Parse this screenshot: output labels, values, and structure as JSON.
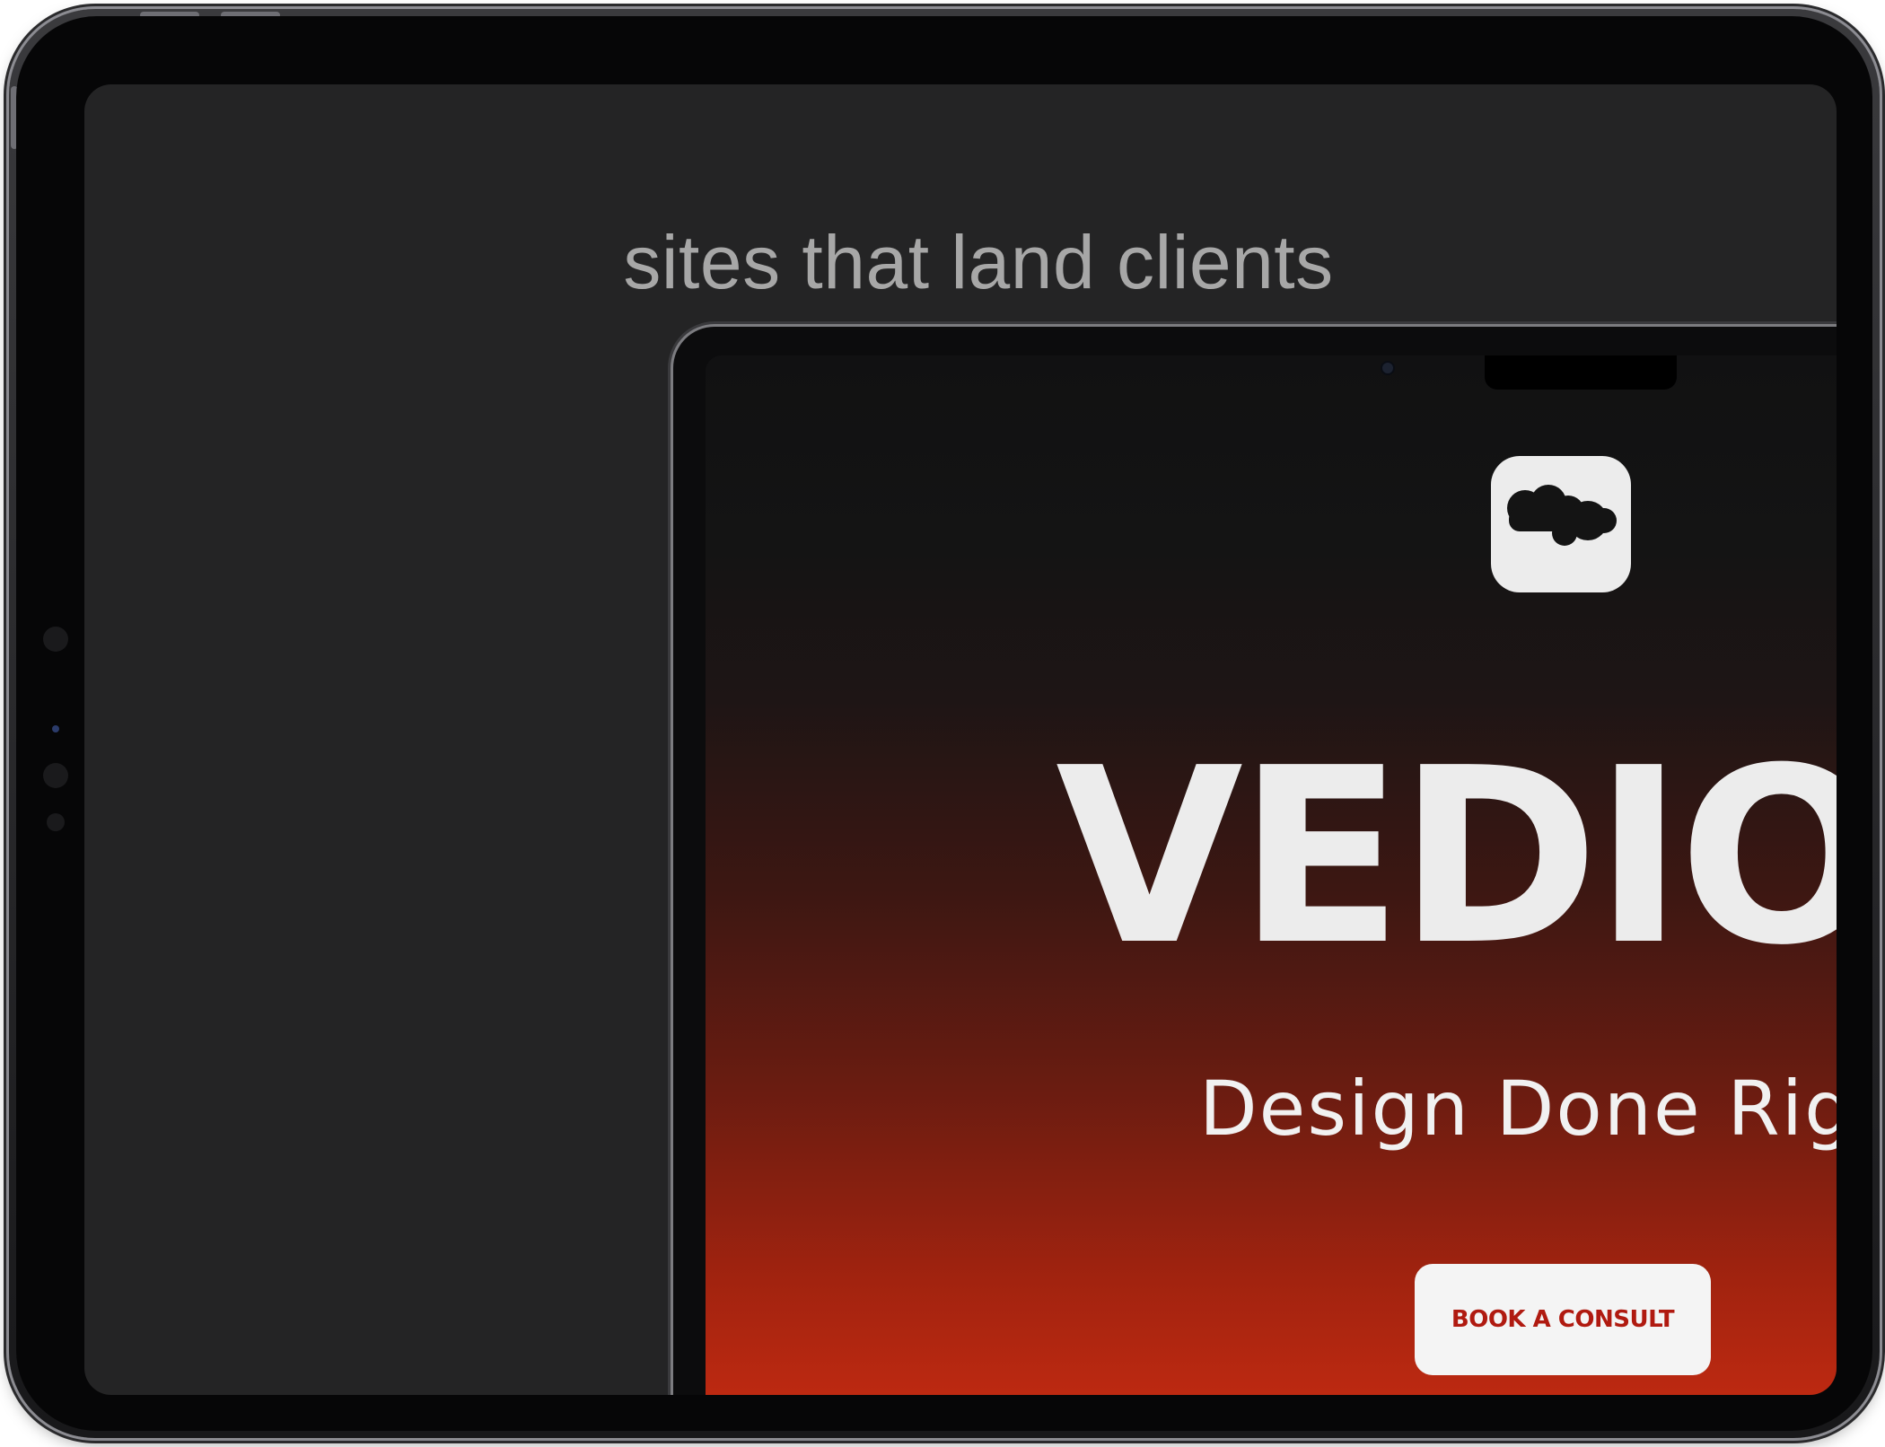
{
  "headline": {
    "tagline": "sites that land clients"
  },
  "mockup_site": {
    "logo_icon": "cloud-logo-icon",
    "brand_word": "VEDIOC",
    "subtitle": "Design Done Rig",
    "cta_label": "BOOK A CONSULT"
  },
  "colors": {
    "screen_background": "#242425",
    "gradient_top": "#111112",
    "gradient_bottom": "#c52b12",
    "cta_text": "#b01a10",
    "tagline_text": "#a7a7a7"
  }
}
